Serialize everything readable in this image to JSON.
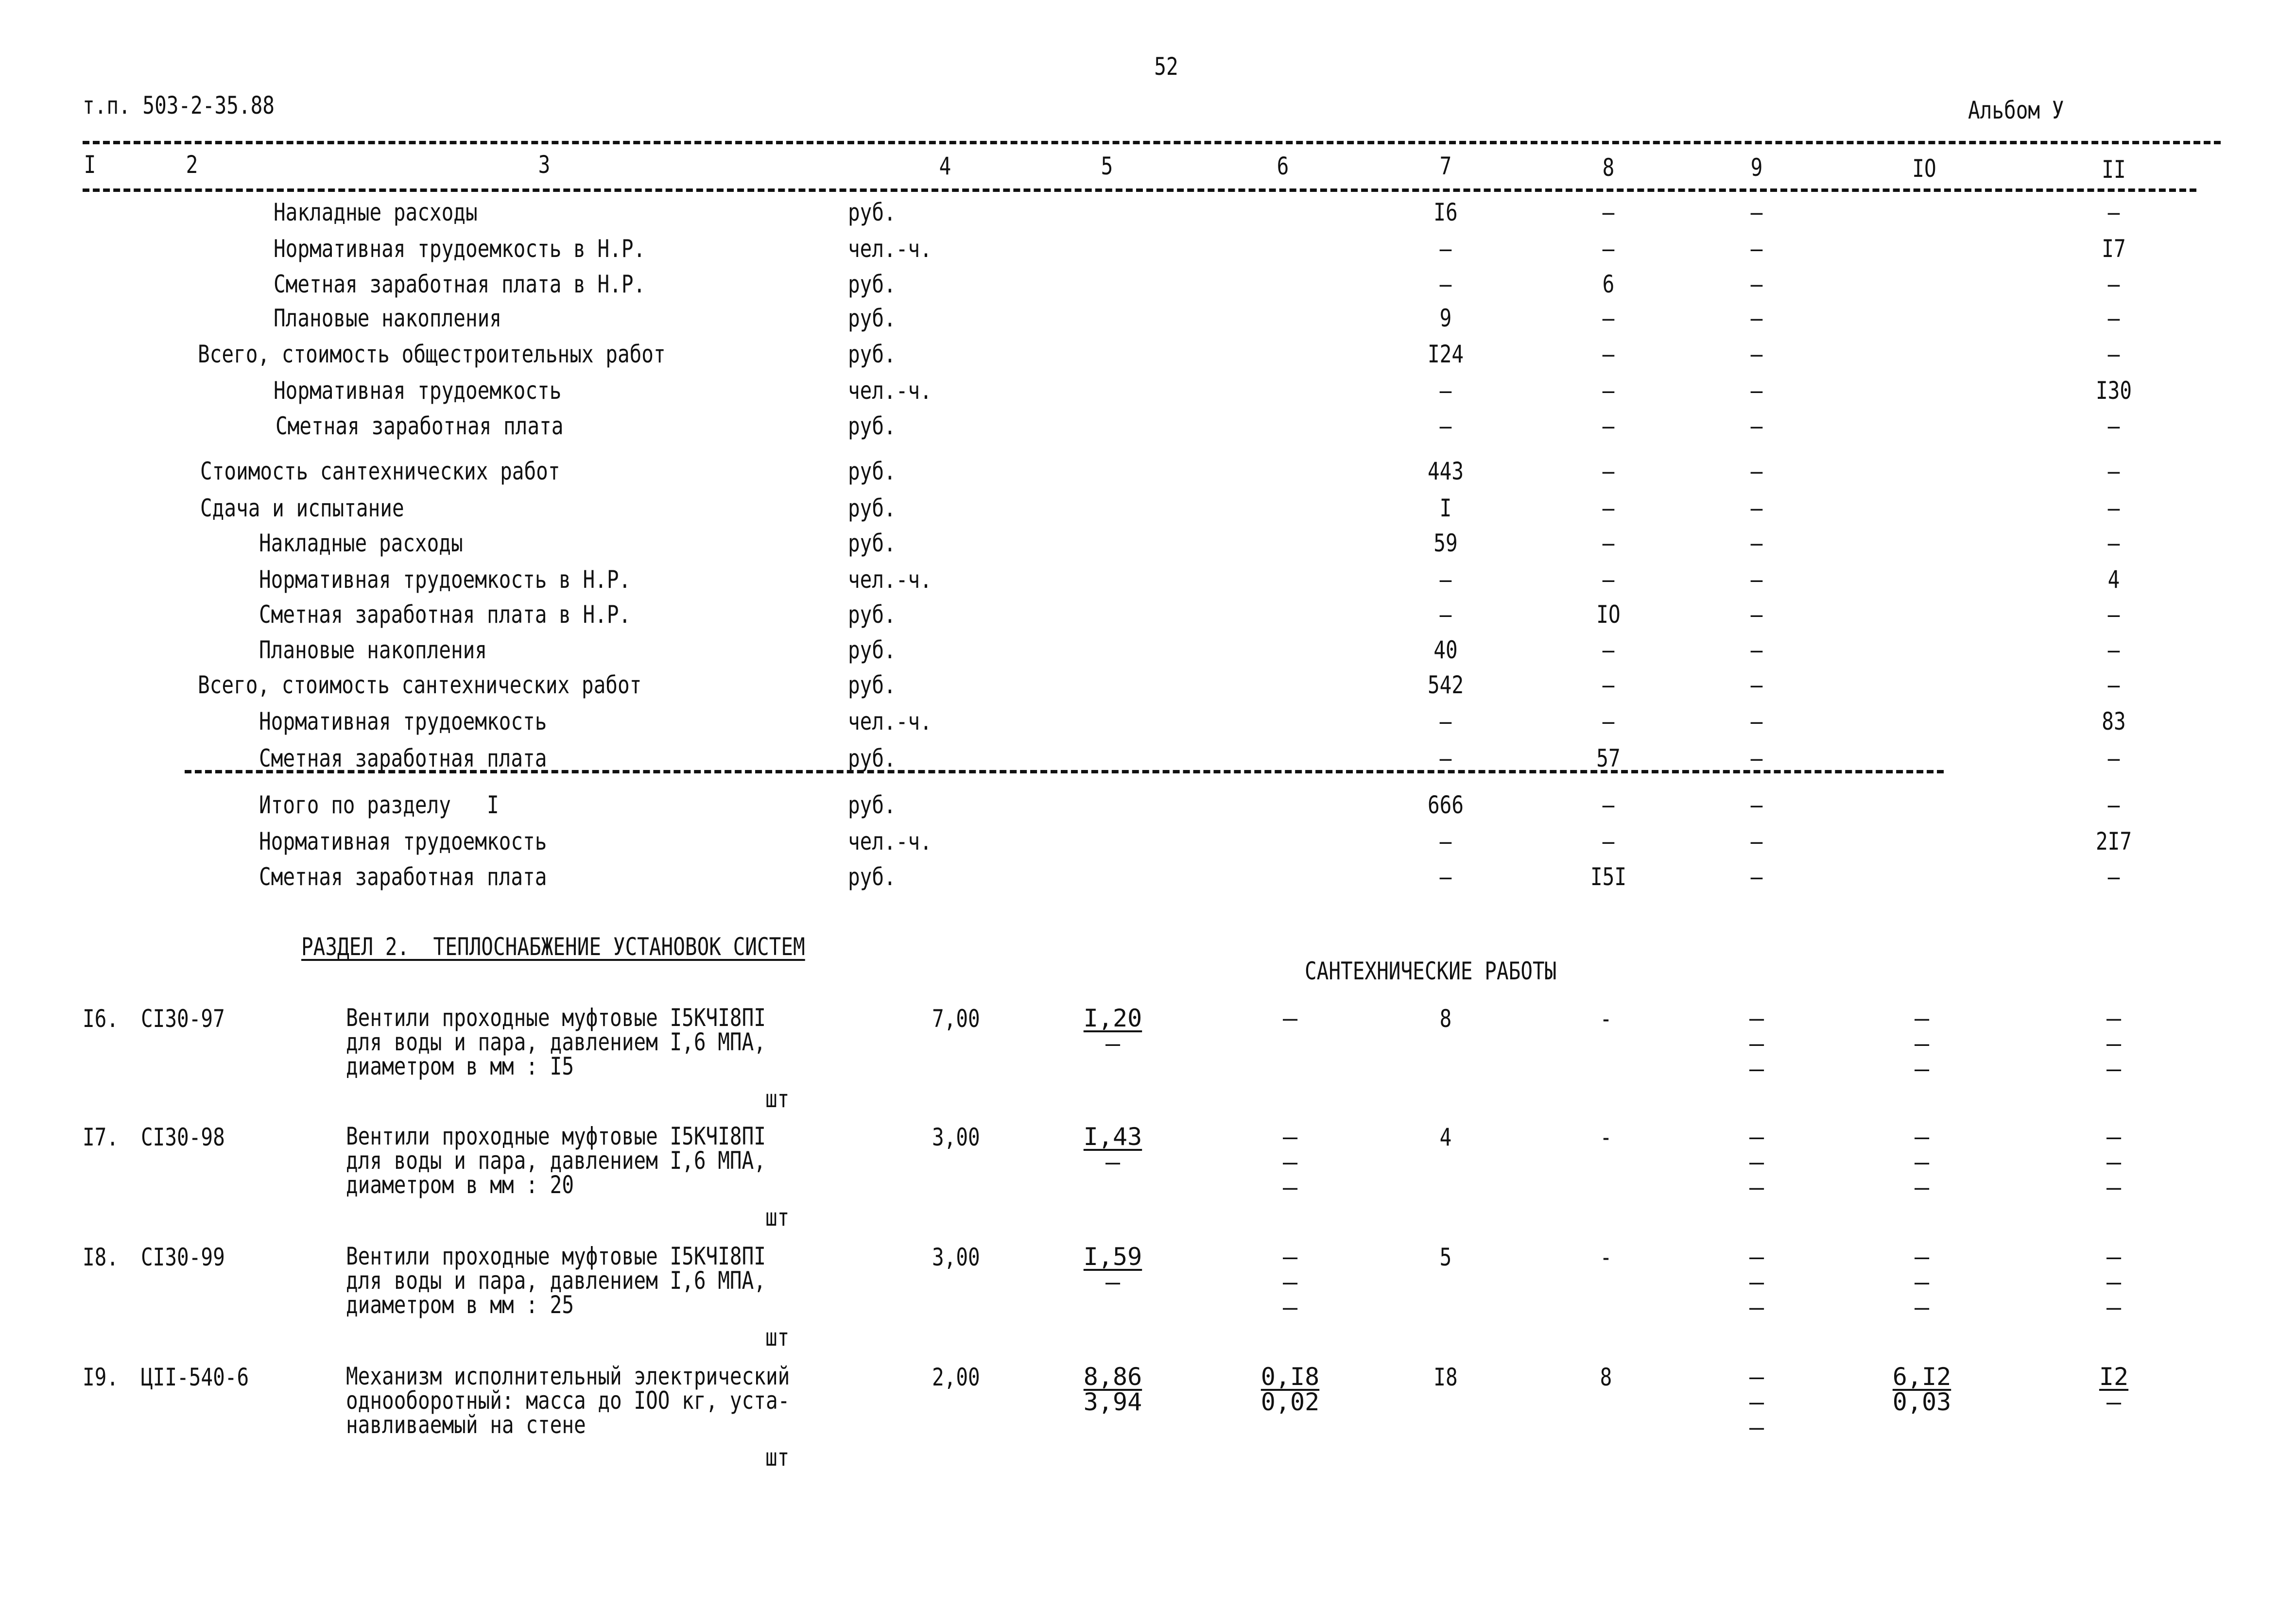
{
  "header": {
    "page_number": "52",
    "doc_code": "т.п. 503-2-35.88",
    "album": "Альбом У",
    "columns": [
      "I",
      "2",
      "3",
      "4",
      "5",
      "6",
      "7",
      "8",
      "9",
      "IO",
      "II"
    ]
  },
  "summary_rows": [
    {
      "label": "Накладные расходы",
      "unit": "руб.",
      "c7": "I6",
      "c8": "–",
      "c9": "–",
      "c11": "–"
    },
    {
      "label": "Нормативная трудоемкость в Н.Р.",
      "unit": "чел.-ч.",
      "c7": "–",
      "c8": "–",
      "c9": "–",
      "c11": "I7"
    },
    {
      "label": "Сметная заработная плата в Н.Р.",
      "unit": "руб.",
      "c7": "–",
      "c8": "6",
      "c9": "–",
      "c11": "–"
    },
    {
      "label": "Плановые накопления",
      "unit": "руб.",
      "c7": "9",
      "c8": "–",
      "c9": "–",
      "c11": "–"
    },
    {
      "label": "Всего, стоимость общестроительных работ",
      "unit": "руб.",
      "c7": "I24",
      "c8": "–",
      "c9": "–",
      "c11": "–"
    },
    {
      "label": "Нормативная трудоемкость",
      "unit": "чел.-ч.",
      "c7": "–",
      "c8": "–",
      "c9": "–",
      "c11": "I30"
    },
    {
      "label": "Сметная заработная плата",
      "unit": "руб.",
      "c7": "–",
      "c8": "–",
      "c9": "–",
      "c11": "–"
    },
    {
      "label": "Стоимость сантехнических работ",
      "unit": "руб.",
      "c7": "443",
      "c8": "–",
      "c9": "–",
      "c11": "–"
    },
    {
      "label": "Сдача и испытание",
      "unit": "руб.",
      "c7": "I",
      "c8": "–",
      "c9": "–",
      "c11": "–"
    },
    {
      "label": "Накладные расходы",
      "unit": "руб.",
      "c7": "59",
      "c8": "–",
      "c9": "–",
      "c11": "–"
    },
    {
      "label": "Нормативная трудоемкость в Н.Р.",
      "unit": "чел.-ч.",
      "c7": "–",
      "c8": "–",
      "c9": "–",
      "c11": "4"
    },
    {
      "label": "Сметная заработная плата в Н.Р.",
      "unit": "руб.",
      "c7": "–",
      "c8": "IO",
      "c9": "–",
      "c11": "–"
    },
    {
      "label": "Плановые накопления",
      "unit": "руб.",
      "c7": "40",
      "c8": "–",
      "c9": "–",
      "c11": "–"
    },
    {
      "label": "Всего, стоимость сантехнических работ",
      "unit": "руб.",
      "c7": "542",
      "c8": "–",
      "c9": "–",
      "c11": "–"
    },
    {
      "label": "Нормативная трудоемкость",
      "unit": "чел.-ч.",
      "c7": "–",
      "c8": "–",
      "c9": "–",
      "c11": "83"
    },
    {
      "label": "Сметная заработная плата",
      "unit": "руб.",
      "c7": "–",
      "c8": "57",
      "c9": "–",
      "c11": "–"
    },
    {
      "label": "Итого по разделу   I",
      "unit": "руб.",
      "c7": "666",
      "c8": "–",
      "c9": "–",
      "c11": "–"
    },
    {
      "label": "Нормативная трудоемкость",
      "unit": "чел.-ч.",
      "c7": "–",
      "c8": "–",
      "c9": "–",
      "c11": "2I7"
    },
    {
      "label": "Сметная заработная плата",
      "unit": "руб.",
      "c7": "–",
      "c8": "I5I",
      "c9": "–",
      "c11": "–"
    }
  ],
  "section2": {
    "title": "РАЗДЕЛ 2.  ТЕПЛОСНАБЖЕНИЕ УСТАНОВОК СИСТЕМ",
    "subtitle": "САНТЕХНИЧЕСКИЕ РАБОТЫ"
  },
  "items": [
    {
      "num": "I6.",
      "code": "CI30-97",
      "desc": [
        "Вентили проходные муфтовые I5КЧI8ПI",
        "для воды и пара, давлением I,6 МПА,",
        "диаметром в мм : I5"
      ],
      "unit": "шт",
      "c4": "7,00",
      "c5": [
        "I,20",
        "–"
      ],
      "c6": [
        "—"
      ],
      "c7": "8",
      "c8": "-",
      "c9": [
        "–",
        "–",
        "–"
      ],
      "c10": [
        "–",
        "–",
        "–"
      ],
      "c11": [
        "–",
        "–",
        "–"
      ]
    },
    {
      "num": "I7.",
      "code": "CI30-98",
      "desc": [
        "Вентили проходные муфтовые I5КЧI8ПI",
        "для воды и пара, давлением I,6 МПА,",
        "диаметром в мм : 20"
      ],
      "unit": "шт",
      "c4": "3,00",
      "c5": [
        "I,43",
        "–"
      ],
      "c6": [
        "–",
        "–",
        "–"
      ],
      "c7": "4",
      "c8": "-",
      "c9": [
        "–",
        "–",
        "–"
      ],
      "c10": [
        "–",
        "–",
        "–"
      ],
      "c11": [
        "–",
        "–",
        "–"
      ]
    },
    {
      "num": "I8.",
      "code": "CI30-99",
      "desc": [
        "Вентили проходные муфтовые I5КЧI8ПI",
        "для воды и пара, давлением I,6 МПА,",
        "диаметром в мм : 25"
      ],
      "unit": "шт",
      "c4": "3,00",
      "c5": [
        "I,59",
        "–"
      ],
      "c6": [
        "–",
        "–",
        "–"
      ],
      "c7": "5",
      "c8": "-",
      "c9": [
        "–",
        "–",
        "–"
      ],
      "c10": [
        "–",
        "–",
        "–"
      ],
      "c11": [
        "–",
        "–",
        "–"
      ]
    },
    {
      "num": "I9.",
      "code": "ЦII-540-6",
      "desc": [
        "Механизм исполнительный электрический",
        "однооборотный: масса до IOO кг, уста-",
        "навливаемый на стене"
      ],
      "unit": "шт",
      "c4": "2,00",
      "c5": [
        "8,86",
        "3,94"
      ],
      "c6": [
        "0,I8",
        "0,02"
      ],
      "c7": "I8",
      "c8": "8",
      "c9": [
        "–",
        "–",
        "–"
      ],
      "c10": [
        "6,I2",
        "0,03"
      ],
      "c11": [
        "I2",
        "–"
      ]
    }
  ]
}
